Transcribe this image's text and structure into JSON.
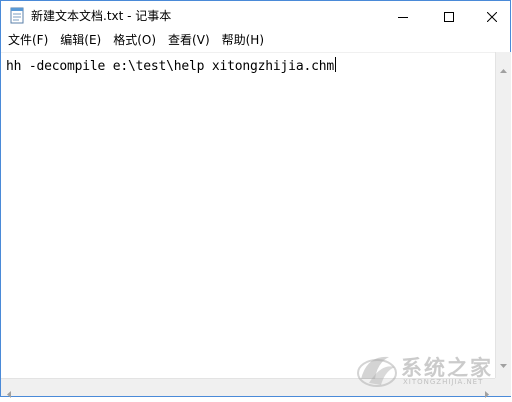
{
  "window": {
    "title": "新建文本文档.txt - 记事本",
    "controls": {
      "minimize_icon": "minimize-icon",
      "maximize_icon": "maximize-icon",
      "close_icon": "close-icon"
    }
  },
  "menubar": {
    "items": [
      {
        "label": "文件(F)"
      },
      {
        "label": "编辑(E)"
      },
      {
        "label": "格式(O)"
      },
      {
        "label": "查看(V)"
      },
      {
        "label": "帮助(H)"
      }
    ]
  },
  "editor": {
    "content": "hh -decompile e:\\test\\help xitongzhijia.chm"
  },
  "watermark": {
    "text": "系统之家",
    "subtext": "XITONGZHIJIA.NET"
  },
  "colors": {
    "border": "#4a8ad8",
    "scrollbar": "#f0f0f0",
    "icon_blue": "#5a9ad6"
  }
}
